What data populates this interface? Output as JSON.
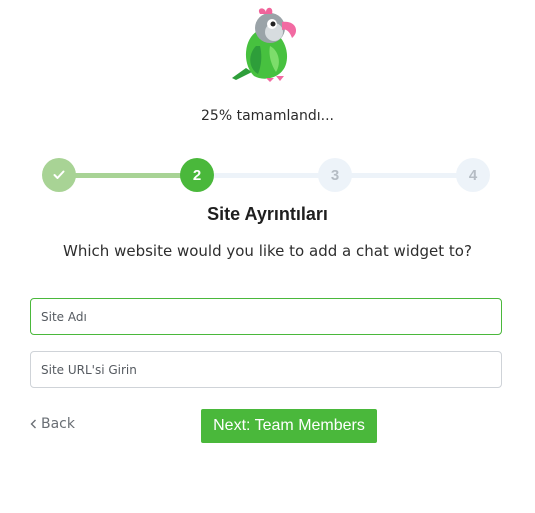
{
  "progress": {
    "text": "25% tamamlandı...",
    "fraction": 0.25
  },
  "stepper": {
    "current_step": 2,
    "steps": [
      {
        "label": "",
        "state": "complete",
        "icon": "check-icon"
      },
      {
        "label": "2",
        "state": "active"
      },
      {
        "label": "3",
        "state": "pending"
      },
      {
        "label": "4",
        "state": "pending"
      }
    ]
  },
  "heading": "Site Ayrıntıları",
  "question": "Which website would you like to add a chat widget to?",
  "form": {
    "site_name_placeholder": "Site Adı",
    "site_name_value": "",
    "site_url_placeholder": "Site URL'si Girin",
    "site_url_value": ""
  },
  "actions": {
    "back_label": "Back",
    "next_label": "Next: Team Members"
  },
  "colors": {
    "accent": "#4ab83b",
    "complete": "#a8d395",
    "pending": "#edf3f9"
  },
  "logo_icon": "parrot-logo"
}
